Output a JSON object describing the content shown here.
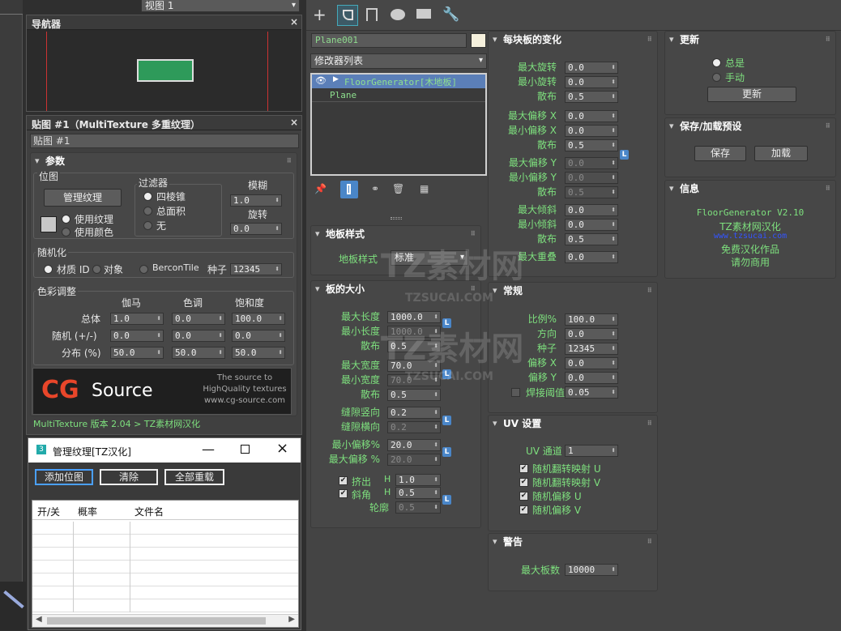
{
  "top": {
    "viewport_label": "视图 1"
  },
  "navigator": {
    "title": "导航器",
    "close": "×"
  },
  "map_panel": {
    "title": "贴图 #1（MultiTexture 多重纹理）",
    "close": "×",
    "name_field": "贴图 #1"
  },
  "params": {
    "header": "参数",
    "bitmap_group": "位图",
    "manage_btn": "管理纹理",
    "use_texture": "使用纹理",
    "use_color": "使用颜色",
    "filter_group": "过滤器",
    "filter_opts": [
      "四棱锥",
      "总面积",
      "无"
    ],
    "blur_label": "模糊",
    "blur_val": "1.0",
    "rotate_label": "旋转",
    "rotate_val": "0.0",
    "random_group": "随机化",
    "rand_material": "材质 ID",
    "rand_object": "对象",
    "rand_bercon": "BerconTile",
    "seed_label": "种子",
    "seed_val": "12345",
    "color_group": "色彩调整",
    "col_heads": [
      "伽马",
      "色调",
      "饱和度"
    ],
    "rows": [
      {
        "label": "总体",
        "vals": [
          "1.0",
          "0.0",
          "100.0"
        ]
      },
      {
        "label": "随机 (+/-)",
        "vals": [
          "0.0",
          "0.0",
          "0.0"
        ]
      },
      {
        "label": "分布 (%)",
        "vals": [
          "50.0",
          "50.0",
          "50.0"
        ]
      }
    ],
    "cg_logo_cg": "CG",
    "cg_logo_source": "Source",
    "cg_tag1": "The source to",
    "cg_tag2": "HighQuality textures",
    "cg_url": "www.cg-source.com",
    "footer": "MultiTexture 版本 2.04    > TZ素材网汉化"
  },
  "manage_dialog": {
    "title": "管理纹理[TZ汉化]",
    "add": "添加位图",
    "clear": "清除",
    "reload": "全部重载",
    "cols": [
      "开/关",
      "概率",
      "文件名"
    ]
  },
  "toolbar": {
    "icons": [
      "plus-icon",
      "modify-icon",
      "hierarchy-icon",
      "motion-icon",
      "display-icon",
      "utilities-icon"
    ]
  },
  "modifier": {
    "object_name": "Plane001",
    "list_label": "修改器列表",
    "stack": [
      "FloorGenerator[木地板]",
      "Plane"
    ]
  },
  "floor_style": {
    "header": "地板样式",
    "label": "地板样式",
    "value": "标准"
  },
  "board_size": {
    "header": "板的大小",
    "rows": [
      {
        "label": "最大长度",
        "val": "1000.0",
        "dis": false
      },
      {
        "label": "最小长度",
        "val": "1000.0",
        "dis": true
      },
      {
        "label": "散布",
        "val": "0.5",
        "dis": false
      },
      {
        "label": "最大宽度",
        "val": "70.0",
        "dis": false
      },
      {
        "label": "最小宽度",
        "val": "70.0",
        "dis": true
      },
      {
        "label": "散布",
        "val": "0.5",
        "dis": false
      },
      {
        "label": "缝隙竖向",
        "val": "0.2",
        "dis": false
      },
      {
        "label": "缝隙横向",
        "val": "0.2",
        "dis": true
      },
      {
        "label": "最小偏移%",
        "val": "20.0",
        "dis": false
      },
      {
        "label": "最大偏移 %",
        "val": "20.0",
        "dis": true
      }
    ],
    "extrude": "挤出",
    "bevel": "斜角",
    "h": "H",
    "extrude_val": "1.0",
    "bevel_val": "0.5",
    "contour": "轮廓",
    "contour_val": "0.5"
  },
  "per_board": {
    "header": "每块板的变化",
    "rows": [
      {
        "label": "最大旋转",
        "val": "0.0",
        "dis": false
      },
      {
        "label": "最小旋转",
        "val": "0.0",
        "dis": false
      },
      {
        "label": "散布",
        "val": "0.5",
        "dis": false
      },
      {
        "label": "最大偏移 X",
        "val": "0.0",
        "dis": false
      },
      {
        "label": "最小偏移 X",
        "val": "0.0",
        "dis": false
      },
      {
        "label": "散布",
        "val": "0.5",
        "dis": false
      },
      {
        "label": "最大偏移 Y",
        "val": "0.0",
        "dis": true
      },
      {
        "label": "最小偏移 Y",
        "val": "0.0",
        "dis": true
      },
      {
        "label": "散布",
        "val": "0.5",
        "dis": true
      },
      {
        "label": "最大倾斜",
        "val": "0.0",
        "dis": false
      },
      {
        "label": "最小倾斜",
        "val": "0.0",
        "dis": false
      },
      {
        "label": "散布",
        "val": "0.5",
        "dis": false
      },
      {
        "label": "最大重叠",
        "val": "0.0",
        "dis": false
      }
    ]
  },
  "general": {
    "header": "常规",
    "rows": [
      {
        "label": "比例%",
        "val": "100.0"
      },
      {
        "label": "方向",
        "val": "0.0"
      },
      {
        "label": "种子",
        "val": "12345"
      },
      {
        "label": "偏移 X",
        "val": "0.0"
      },
      {
        "label": "偏移 Y",
        "val": "0.0"
      }
    ],
    "weld_label": "焊接阈值",
    "weld_val": "0.05"
  },
  "uv": {
    "header": "UV 设置",
    "channel_label": "UV 通道",
    "channel_val": "1",
    "checks": [
      "随机翻转映射 U",
      "随机翻转映射 V",
      "随机偏移 U",
      "随机偏移 V"
    ]
  },
  "warning": {
    "header": "警告",
    "label": "最大板数",
    "val": "10000"
  },
  "update": {
    "header": "更新",
    "always": "总是",
    "manual": "手动",
    "btn": "更新"
  },
  "presets": {
    "header": "保存/加载预设",
    "save": "保存",
    "load": "加载"
  },
  "info": {
    "header": "信息",
    "line1": "FloorGenerator V2.10",
    "line2": "TZ素材网汉化",
    "line3": "www.tzsucai.com",
    "line4": "免费汉化作品",
    "line5": "请勿商用"
  },
  "watermark": {
    "t1": "TZ素材网",
    "t2": "TZSUCAI.COM"
  }
}
